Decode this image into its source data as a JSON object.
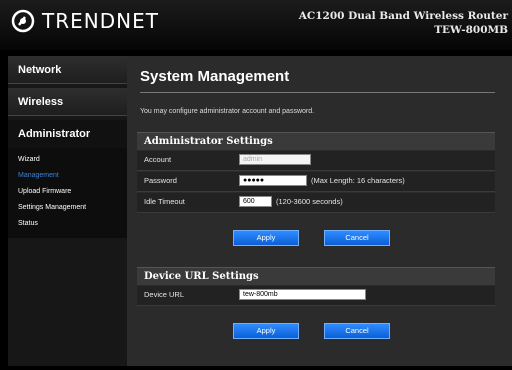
{
  "header": {
    "brand": "TRENDNET",
    "model_line1": "AC1200 Dual Band Wireless Router",
    "model_line2": "TEW-800MB"
  },
  "sidebar": {
    "items": [
      {
        "label": "Network"
      },
      {
        "label": "Wireless"
      },
      {
        "label": "Administrator"
      }
    ],
    "submenu": [
      {
        "label": "Wizard"
      },
      {
        "label": "Management"
      },
      {
        "label": "Upload Firmware"
      },
      {
        "label": "Settings Management"
      },
      {
        "label": "Status"
      }
    ]
  },
  "main": {
    "title": "System Management",
    "description": "You may configure administrator account and password.",
    "admin_section": {
      "heading": "Administrator Settings",
      "account_label": "Account",
      "account_value": "admin",
      "password_label": "Password",
      "password_value": "●●●●●",
      "password_hint": "(Max Length: 16 characters)",
      "timeout_label": "Idle Timeout",
      "timeout_value": "600",
      "timeout_hint": "(120-3600 seconds)",
      "apply_label": "Apply",
      "cancel_label": "Cancel"
    },
    "url_section": {
      "heading": "Device URL Settings",
      "url_label": "Device URL",
      "url_value": "tew-800mb",
      "apply_label": "Apply",
      "cancel_label": "Cancel"
    }
  },
  "colors": {
    "accent_blue": "#2f8cff",
    "active_submenu": "#3b82d6",
    "panel_background": "#2b2b2b"
  }
}
